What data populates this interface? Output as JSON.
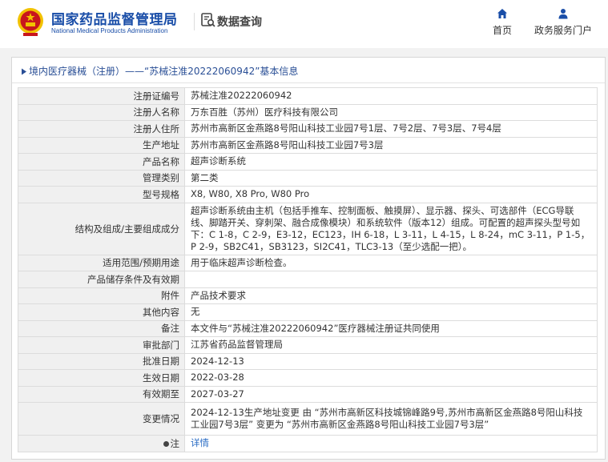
{
  "header": {
    "site_title_cn": "国家药品监督管理局",
    "site_title_en": "National Medical Products Administration",
    "query_label": "数据查询",
    "nav": [
      {
        "label": "首页",
        "icon": "home-icon"
      },
      {
        "label": "政务服务门户",
        "icon": "user-icon"
      }
    ]
  },
  "breadcrumb": {
    "prefix": "境内医疗器械（注册）",
    "separator": "——",
    "title": "“苏械注准20222060942”基本信息"
  },
  "rows": [
    {
      "label": "注册证编号",
      "value": "苏械注准20222060942"
    },
    {
      "label": "注册人名称",
      "value": "万东百胜（苏州）医疗科技有限公司"
    },
    {
      "label": "注册人住所",
      "value": "苏州市高新区金燕路8号阳山科技工业园7号1层、7号2层、7号3层、7号4层"
    },
    {
      "label": "生产地址",
      "value": "苏州市高新区金燕路8号阳山科技工业园7号3层"
    },
    {
      "label": "产品名称",
      "value": "超声诊断系统"
    },
    {
      "label": "管理类别",
      "value": "第二类"
    },
    {
      "label": "型号规格",
      "value": "X8, W80, X8 Pro, W80 Pro"
    },
    {
      "label": "结构及组成/主要组成成分",
      "value": "超声诊断系统由主机（包括手推车、控制面板、触摸屏）、显示器、探头、可选部件（ECG导联线、脚踏开关、穿刺架、融合成像模块）和系统软件（版本12）组成。可配置的超声探头型号如下：C 1-8，C 2-9，E3-12，EC123，IH 6-18，L 3-11，L 4-15，L 8-24，mC 3-11，P 1-5，P 2-9，SB2C41，SB3123，SI2C41，TLC3-13（至少选配一把）。"
    },
    {
      "label": "适用范围/预期用途",
      "value": "用于临床超声诊断检查。"
    },
    {
      "label": "产品储存条件及有效期",
      "value": ""
    },
    {
      "label": "附件",
      "value": "产品技术要求"
    },
    {
      "label": "其他内容",
      "value": "无"
    },
    {
      "label": "备注",
      "value": "本文件与“苏械注准20222060942”医疗器械注册证共同使用"
    },
    {
      "label": "审批部门",
      "value": "江苏省药品监督管理局"
    },
    {
      "label": "批准日期",
      "value": "2024-12-13"
    },
    {
      "label": "生效日期",
      "value": "2022-03-28"
    },
    {
      "label": "有效期至",
      "value": "2027-03-27"
    },
    {
      "label": "变更情况",
      "value": "2024-12-13生产地址变更 由 “苏州市高新区科技城锦峰路9号,苏州市高新区金燕路8号阳山科技工业园7号3层” 变更为 “苏州市高新区金燕路8号阳山科技工业园7号3层”"
    },
    {
      "label": "注",
      "value": "详情"
    }
  ],
  "colors": {
    "brand_blue": "#1a4ea8",
    "link_blue": "#2a6cc4",
    "label_bg": "#f0f0f0",
    "emblem_red": "#c8161d",
    "emblem_gold": "#f2c200"
  }
}
